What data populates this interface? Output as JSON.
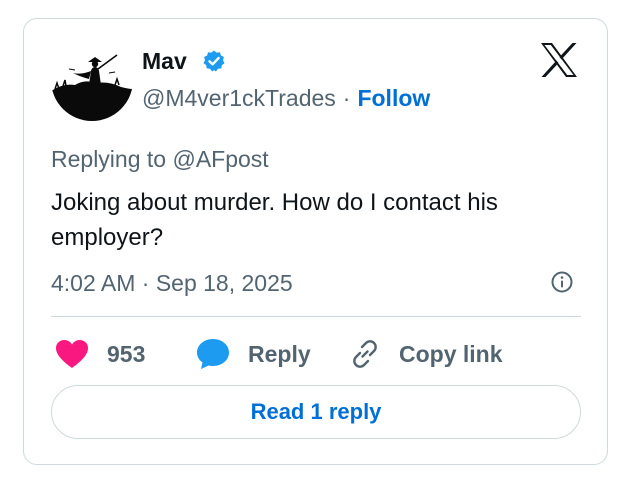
{
  "author": {
    "display_name": "Mav",
    "handle": "@M4ver1ckTrades",
    "separator": "·",
    "follow_label": "Follow",
    "verified": true
  },
  "reply_context": {
    "prefix": "Replying to",
    "target": "@AFpost"
  },
  "tweet": {
    "text": "Joking about murder. How do I contact his employer?",
    "timestamp": "4:02 AM · Sep 18, 2025"
  },
  "actions": {
    "like_count": "953",
    "reply_label": "Reply",
    "copy_link_label": "Copy link"
  },
  "read_replies_label": "Read 1 reply",
  "icons": {
    "logo": "x-logo-icon",
    "verified": "verified-badge-icon",
    "info": "info-icon",
    "like": "heart-icon",
    "reply": "speech-bubble-icon",
    "copy": "link-icon"
  },
  "colors": {
    "accent": "#006fd6",
    "verified": "#1d9bf0",
    "heart": "#f91880",
    "reply_bubble": "#1d9bf0",
    "muted_text": "#536471",
    "text": "#0f1419",
    "border": "#cfd9de"
  }
}
